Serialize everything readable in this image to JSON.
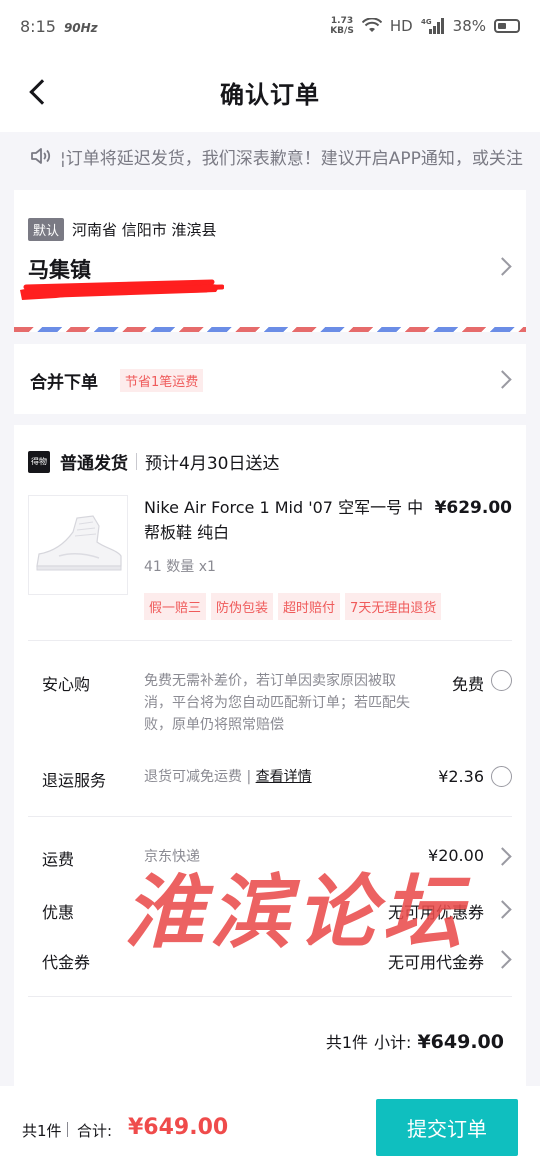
{
  "status_bar": {
    "time": "8:15",
    "refresh_rate": "90Hz",
    "net_speed_value": "1.73",
    "net_speed_unit": "KB/S",
    "hd": "HD",
    "network": "4G",
    "battery": "38%"
  },
  "nav": {
    "title": "确认订单",
    "back_icon": "chevron-left-icon"
  },
  "notice": {
    "icon": "speaker-icon",
    "text": "¦订单将延迟发货，我们深表歉意！建议开启APP通知，或关注"
  },
  "address": {
    "default_tag": "默认",
    "region": "河南省 信阳市 淮滨县",
    "town": "马集镇"
  },
  "merge": {
    "title": "合并下单",
    "tag": "节省1笔运费"
  },
  "order": {
    "logo_text": "得物",
    "shipping_type": "普通发货",
    "eta": "预计4月30日送达",
    "product": {
      "title": "Nike Air Force 1 Mid '07 空军一号 中帮板鞋 纯白",
      "price": "¥629.00",
      "spec": "41 数量 x1",
      "tags": [
        "假一赔三",
        "防伪包装",
        "超时赔付",
        "7天无理由退货"
      ]
    },
    "services": {
      "anxin": {
        "label": "安心购",
        "desc": "免费无需补差价，若订单因卖家原因被取消，平台将为您自动匹配新订单；若匹配失败，原单仍将照常赔偿",
        "value": "免费"
      },
      "return": {
        "label": "退运服务",
        "desc": "退货可减免运费",
        "link": "查看详情",
        "value": "¥2.36"
      }
    },
    "fees": {
      "shipping": {
        "label": "运费",
        "carrier": "京东快递",
        "value": "¥20.00"
      },
      "discount": {
        "label": "优惠",
        "value": "无可用优惠券"
      },
      "voucher": {
        "label": "代金券",
        "value": "无可用代金券"
      }
    },
    "subtotal": {
      "count": "共1件",
      "label": "小计:",
      "amount": "¥649.00"
    }
  },
  "watermark": "淮滨论坛",
  "bottom": {
    "count": "共1件",
    "total_label": "合计:",
    "total_amount": "¥649.00",
    "submit_label": "提交订单"
  },
  "colors": {
    "accent": "#0fbfbf",
    "price_red": "#ef4b4b",
    "tag_red": "#ef5b5b"
  }
}
